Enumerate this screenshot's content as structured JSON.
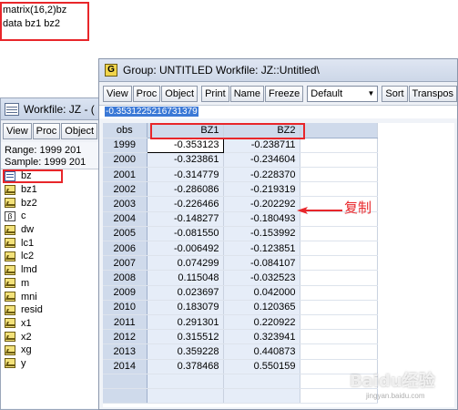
{
  "command": {
    "lines": [
      "matrix(16,2)bz",
      "data bz1 bz2"
    ]
  },
  "workfile": {
    "title": "Workfile: JZ - (",
    "toolbar": [
      "View",
      "Proc",
      "Object"
    ],
    "range": "Range:   1999 201",
    "sample": "Sample: 1999 201",
    "objects": [
      {
        "name": "bz",
        "icon": "matrix-icon"
      },
      {
        "name": "bz1",
        "icon": "series-icon"
      },
      {
        "name": "bz2",
        "icon": "series-icon"
      },
      {
        "name": "c",
        "icon": "coef-icon"
      },
      {
        "name": "dw",
        "icon": "series-icon"
      },
      {
        "name": "lc1",
        "icon": "series-icon"
      },
      {
        "name": "lc2",
        "icon": "series-icon"
      },
      {
        "name": "lmd",
        "icon": "series-icon"
      },
      {
        "name": "m",
        "icon": "series-icon"
      },
      {
        "name": "mni",
        "icon": "series-icon"
      },
      {
        "name": "resid",
        "icon": "series-icon"
      },
      {
        "name": "x1",
        "icon": "series-icon"
      },
      {
        "name": "x2",
        "icon": "series-icon"
      },
      {
        "name": "xg",
        "icon": "series-icon"
      },
      {
        "name": "y",
        "icon": "series-icon"
      }
    ]
  },
  "group": {
    "icon_letter": "G",
    "title": "Group: UNTITLED    Workfile: JZ::Untitled\\",
    "toolbar": [
      "View",
      "Proc",
      "Object",
      "Print",
      "Name",
      "Freeze"
    ],
    "format_select": "Default",
    "toolbar_right": [
      "Sort",
      "Transpos"
    ],
    "edit_value": "-0.3531225216731379",
    "headers": {
      "obs": "obs",
      "c1": "BZ1",
      "c2": "BZ2"
    },
    "rows": [
      {
        "obs": "1999",
        "bz1": "-0.353123",
        "bz2": "-0.238711"
      },
      {
        "obs": "2000",
        "bz1": "-0.323861",
        "bz2": "-0.234604"
      },
      {
        "obs": "2001",
        "bz1": "-0.314779",
        "bz2": "-0.228370"
      },
      {
        "obs": "2002",
        "bz1": "-0.286086",
        "bz2": "-0.219319"
      },
      {
        "obs": "2003",
        "bz1": "-0.226466",
        "bz2": "-0.202292"
      },
      {
        "obs": "2004",
        "bz1": "-0.148277",
        "bz2": "-0.180493"
      },
      {
        "obs": "2005",
        "bz1": "-0.081550",
        "bz2": "-0.153992"
      },
      {
        "obs": "2006",
        "bz1": "-0.006492",
        "bz2": "-0.123851"
      },
      {
        "obs": "2007",
        "bz1": "0.074299",
        "bz2": "-0.084107"
      },
      {
        "obs": "2008",
        "bz1": "0.115048",
        "bz2": "-0.032523"
      },
      {
        "obs": "2009",
        "bz1": "0.023697",
        "bz2": "0.042000"
      },
      {
        "obs": "2010",
        "bz1": "0.183079",
        "bz2": "0.120365"
      },
      {
        "obs": "2011",
        "bz1": "0.291301",
        "bz2": "0.220922"
      },
      {
        "obs": "2012",
        "bz1": "0.315512",
        "bz2": "0.323941"
      },
      {
        "obs": "2013",
        "bz1": "0.359228",
        "bz2": "0.440873"
      },
      {
        "obs": "2014",
        "bz1": "0.378468",
        "bz2": "0.550159"
      }
    ]
  },
  "annotation": {
    "text": "复制",
    "color": "#e8262a"
  },
  "watermark": {
    "text": "Baidu经验",
    "sub": "jingyan.baidu.com"
  },
  "colors": {
    "highlight": "#e8262a",
    "header_bg": "#cfdaeb",
    "cell_bg": "#e6edf8",
    "selection": "#3a78d6"
  }
}
